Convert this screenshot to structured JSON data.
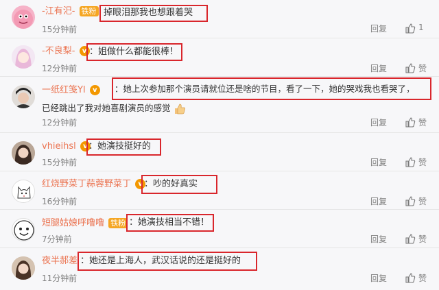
{
  "comments": [
    {
      "user": "-江有汜-",
      "badge": "铁粉",
      "badge_type": "fan",
      "text": "掉眼泪那我也想跟着哭",
      "time": "15分钟前",
      "reply": "回复",
      "likes": "1"
    },
    {
      "user": "-不良梨-",
      "badge": "",
      "badge_type": "vip",
      "text": "：姐做什么都能很棒！",
      "time": "12分钟前",
      "reply": "回复",
      "likes": "赞"
    },
    {
      "user": "一纸红笺Yl",
      "badge": "",
      "badge_type": "vip-fan",
      "text": "：她上次参加那个演员请就位还是啥的节目，看了一下，她的哭戏我也看哭了，",
      "text2": "已经跳出了我对她喜剧演员的感觉",
      "time": "12分钟前",
      "reply": "回复",
      "likes": "赞"
    },
    {
      "user": "vhieihsl",
      "badge": "",
      "badge_type": "vip",
      "text": "：她演技挺好的",
      "time": "15分钟前",
      "reply": "回复",
      "likes": "赞"
    },
    {
      "user": "红烧野菜丁蒜蓉野菜丁",
      "badge": "",
      "badge_type": "vip",
      "text": "：吵的好真实",
      "time": "16分钟前",
      "reply": "回复",
      "likes": "赞"
    },
    {
      "user": "短腿姑娘呼噜噜",
      "badge": "铁粉",
      "badge_type": "fan",
      "text": "：她演技相当不错！",
      "time": "7分钟前",
      "reply": "回复",
      "likes": "赞"
    },
    {
      "user": "夜半郝差",
      "badge": "",
      "badge_type": "none",
      "text": "：她还是上海人，武汉话说的还是挺好的",
      "time": "11分钟前",
      "reply": "回复",
      "likes": "赞"
    }
  ],
  "colors": {
    "highlight": "#d9262c",
    "username": "#eb7350"
  }
}
